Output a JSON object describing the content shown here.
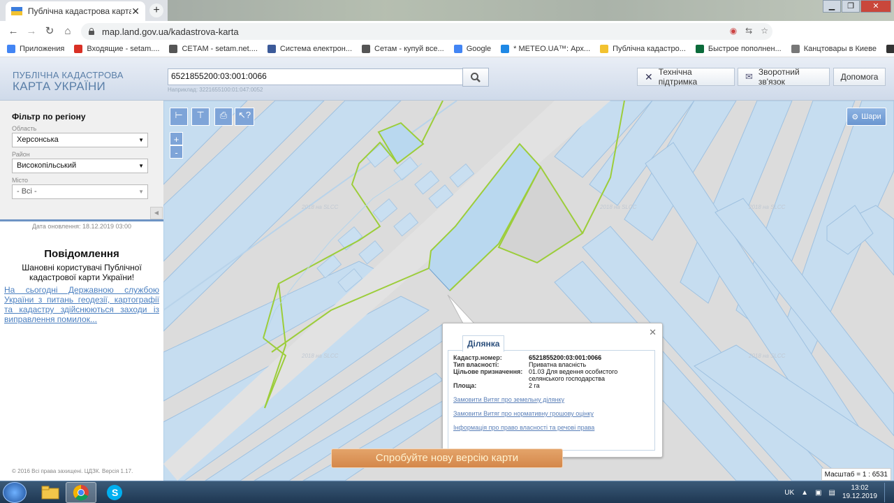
{
  "browser": {
    "tab_title": "Публічна кадастрова карта Укр",
    "url": "map.land.gov.ua/kadastrova-karta"
  },
  "bookmarks": [
    {
      "label": "Приложения",
      "icon": "apps-icon",
      "color": "#4285f4"
    },
    {
      "label": "Входящие - setam....",
      "icon": "gmail-icon",
      "color": "#d93025"
    },
    {
      "label": "СЕТАМ - setam.net....",
      "icon": "globe-icon",
      "color": "#555555"
    },
    {
      "label": "Система електрон...",
      "icon": "shield-icon",
      "color": "#3c5a99"
    },
    {
      "label": "Сетам - купуй все...",
      "icon": "globe-icon",
      "color": "#555555"
    },
    {
      "label": "Google",
      "icon": "google-icon",
      "color": "#4285f4"
    },
    {
      "label": "* METEO.UA™: Арх...",
      "icon": "umbrella-icon",
      "color": "#1e88e5"
    },
    {
      "label": "Публічна кадастро...",
      "icon": "ua-flag-icon",
      "color": "#f2c230"
    },
    {
      "label": "Быстрое пополнен...",
      "icon": "o-icon",
      "color": "#0b6b3a"
    },
    {
      "label": "Канцтовары в Киеве",
      "icon": "cart-icon",
      "color": "#777777"
    },
    {
      "label": "BM",
      "icon": "bm-icon",
      "color": "#333333"
    }
  ],
  "header": {
    "logo_line1": "ПУБЛІЧНА КАДАСТРОВА",
    "logo_line2": "КАРТА УКРАЇНИ",
    "search_value": "6521855200:03:001:0066",
    "search_hint": "Наприклад: 3221655100:01:047:0052",
    "buttons": {
      "support": "Технічна підтримка",
      "feedback": "Зворотний зв'язок",
      "help": "Допомога"
    }
  },
  "filter": {
    "title": "Фільтр по регіону",
    "region_label": "Область",
    "region_value": "Херсонська",
    "district_label": "Район",
    "district_value": "Високопільський",
    "city_label": "Місто",
    "city_value": "- Всі -",
    "updated": "Дата оновлення: 18.12.2019 03:00"
  },
  "notice": {
    "title": "Повідомлення",
    "subtitle": "Шановні користувачі Публічної кадастрової карти України!",
    "link": "На сьогодні Державною службою України з питань геодезії, картографії та кадастру здійснюються заходи із виправлення помилок..."
  },
  "copyright": "© 2016 Всі права захищені. ЦДЗК. Версія 1.17.",
  "map": {
    "layers_label": "Шари",
    "zoom_in": "+",
    "zoom_out": "-",
    "watermark": "2018 на SLCC",
    "new_version": "Спробуйте нову версію карти",
    "scale": "Масштаб = 1 : 6531"
  },
  "popup": {
    "tab": "Ділянка",
    "rows": [
      {
        "k": "Кадастр.номер:",
        "v": "6521855200:03:001:0066"
      },
      {
        "k": "Тип власності:",
        "v": "Приватна власність"
      },
      {
        "k": "Цільове призначення:",
        "v": "01.03 Для ведення особистого селянського господарства"
      },
      {
        "k": "Площа:",
        "v": "2 га"
      }
    ],
    "links": [
      "Замовити Витяг про земельну ділянку",
      "Замовити Витяг про нормативну грошову оцінку",
      "Інформація про право власності та речові права"
    ]
  },
  "taskbar": {
    "lang": "UK",
    "time": "13:02",
    "date": "19.12.2019"
  }
}
